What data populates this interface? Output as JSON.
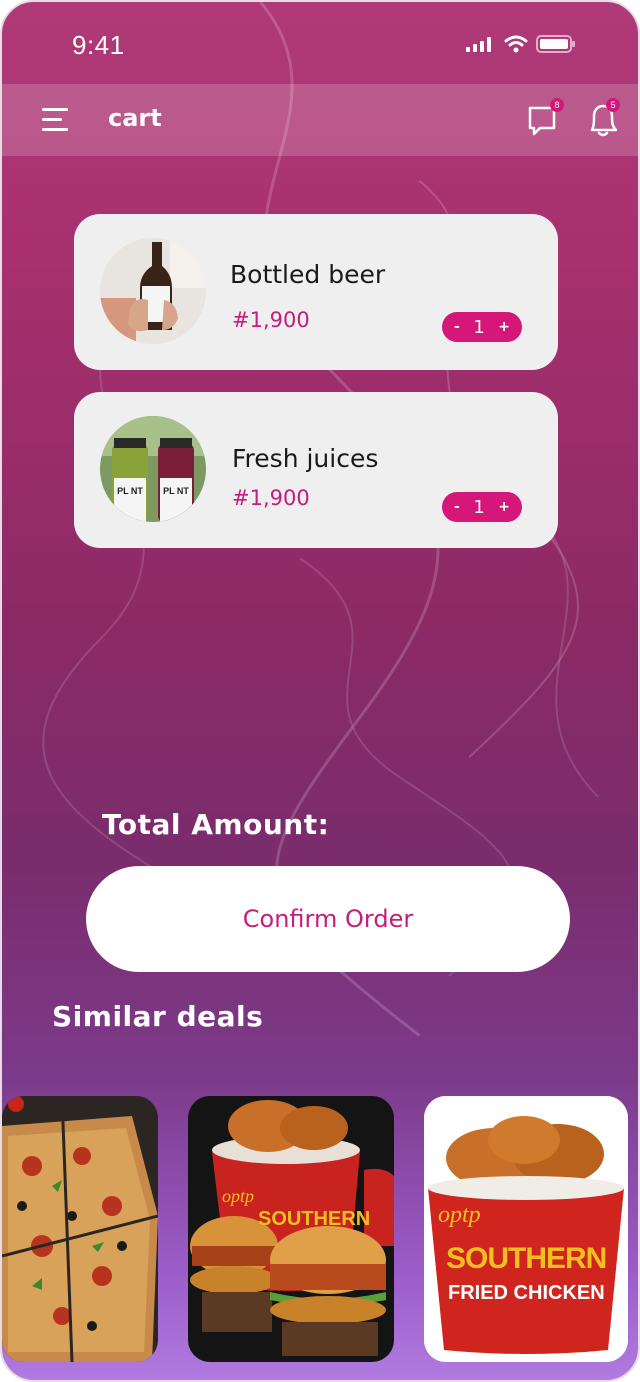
{
  "status_bar": {
    "time": "9:41"
  },
  "header": {
    "title": "cart",
    "chat_badge": "8",
    "notification_badge": "5"
  },
  "cart": {
    "items": [
      {
        "name": "Bottled beer",
        "price": "#1,900",
        "qty": "1",
        "minus": "-",
        "plus": "+"
      },
      {
        "name": "Fresh juices",
        "price": "#1,900",
        "qty": "1",
        "minus": "-",
        "plus": "+"
      }
    ],
    "juice_bottle_label": "PL NT"
  },
  "total": {
    "label": "Total Amount:"
  },
  "confirm": {
    "label": "Confirm Order"
  },
  "deals": {
    "title": "Similar deals",
    "cards": [
      {
        "name": "pizza"
      },
      {
        "name": "fried-chicken-burgers",
        "bucket_brand": "optp",
        "bucket_text": "SOUTHERN"
      },
      {
        "name": "southern-fried-chicken-bucket",
        "bucket_brand": "optp",
        "bucket_text_1": "SOUTHERN",
        "bucket_text_2": "FRIED CHICKEN"
      }
    ]
  },
  "colors": {
    "accent": "#d6177a",
    "price": "#c21f7c"
  }
}
